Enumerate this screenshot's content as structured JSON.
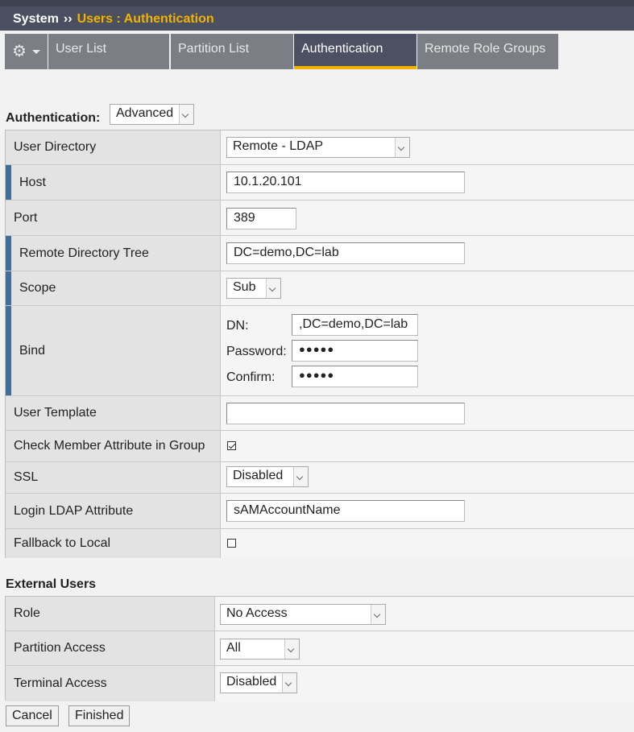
{
  "breadcrumb": {
    "root": "System",
    "separator": "››",
    "current": "Users : Authentication"
  },
  "tabs": [
    {
      "label": ""
    },
    {
      "label": "User List"
    },
    {
      "label": "Partition List"
    },
    {
      "label": "Authentication"
    },
    {
      "label": "Remote Role Groups"
    }
  ],
  "auth": {
    "label": "Authentication:",
    "mode": "Advanced"
  },
  "settings": {
    "user_directory": {
      "label": "User Directory",
      "value": "Remote - LDAP"
    },
    "host": {
      "label": "Host",
      "value": "10.1.20.101"
    },
    "port": {
      "label": "Port",
      "value": "389"
    },
    "tree": {
      "label": "Remote Directory Tree",
      "value": "DC=demo,DC=lab"
    },
    "scope": {
      "label": "Scope",
      "value": "Sub"
    },
    "bind": {
      "label": "Bind",
      "dn_label": "DN:",
      "dn_value": ",DC=demo,DC=lab",
      "password_label": "Password:",
      "password_value": "●●●●●",
      "confirm_label": "Confirm:",
      "confirm_value": "●●●●●"
    },
    "user_template": {
      "label": "User Template",
      "value": ""
    },
    "check_member": {
      "label": "Check Member Attribute in Group",
      "checked": true
    },
    "ssl": {
      "label": "SSL",
      "value": "Disabled"
    },
    "login_attr": {
      "label": "Login LDAP Attribute",
      "value": "sAMAccountName"
    },
    "fallback": {
      "label": "Fallback to Local",
      "checked": false
    }
  },
  "external": {
    "title": "External Users",
    "role": {
      "label": "Role",
      "value": "No Access"
    },
    "partition": {
      "label": "Partition Access",
      "value": "All"
    },
    "terminal": {
      "label": "Terminal Access",
      "value": "Disabled"
    }
  },
  "buttons": {
    "cancel": "Cancel",
    "finished": "Finished"
  },
  "colors": {
    "accent": "#f2b200",
    "required_bar": "#3a6fa6",
    "header": "#4a5060"
  }
}
